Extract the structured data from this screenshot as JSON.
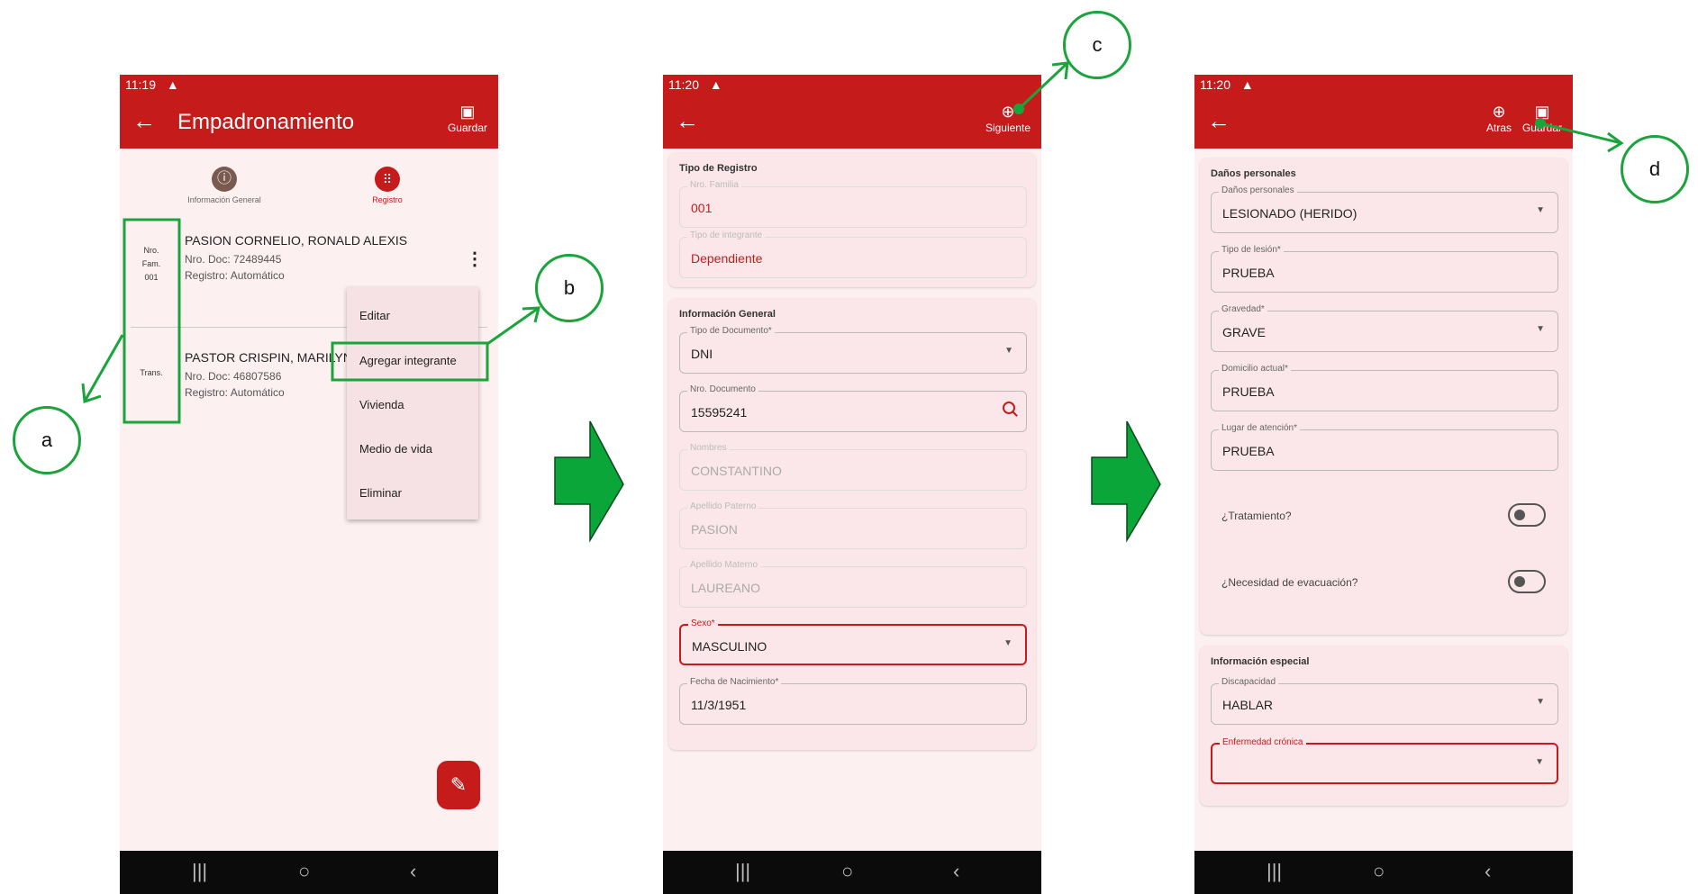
{
  "screen1": {
    "status": {
      "time": "11:19",
      "warn": "▲"
    },
    "appbar": {
      "title": "Empadronamiento",
      "save_label": "Guardar"
    },
    "tabs": [
      {
        "label": "Información General",
        "icon": "info-icon"
      },
      {
        "label": "Registro",
        "icon": "dialpad-icon"
      }
    ],
    "records": [
      {
        "badge": [
          "Nro.",
          "Fam.",
          "001"
        ],
        "name": "PASION CORNELIO, RONALD ALEXIS",
        "doc": "Nro. Doc: 72489445",
        "reg": "Registro: Automático"
      },
      {
        "badge": [
          "Trans."
        ],
        "name": "PASTOR CRISPIN, MARILYN",
        "doc": "Nro. Doc: 46807586",
        "reg": "Registro: Automático"
      }
    ],
    "menu": [
      "Editar",
      "Agregar integrante",
      "Vivienda",
      "Medio de vida",
      "Eliminar"
    ]
  },
  "screen2": {
    "status": {
      "time": "11:20",
      "warn": "▲"
    },
    "appbar": {
      "next_label": "Siguiente"
    },
    "section1": {
      "title": "Tipo de Registro",
      "fields": [
        {
          "label": "Nro. Familia",
          "value": "001"
        },
        {
          "label": "Tipo de integrante",
          "value": "Dependiente"
        }
      ]
    },
    "section2": {
      "title": "Información General",
      "fields": [
        {
          "label": "Tipo de Documento*",
          "value": "DNI"
        },
        {
          "label": "Nro. Documento",
          "value": "15595241"
        },
        {
          "label": "Nombres",
          "value": "CONSTANTINO"
        },
        {
          "label": "Apellido Paterno",
          "value": "PASION"
        },
        {
          "label": "Apellido Materno",
          "value": "LAUREANO"
        },
        {
          "label": "Sexo*",
          "value": "MASCULINO"
        },
        {
          "label": "Fecha de Nacimiento*",
          "value": "11/3/1951"
        }
      ]
    }
  },
  "screen3": {
    "status": {
      "time": "11:20",
      "warn": "▲"
    },
    "appbar": {
      "back_label": "Atras",
      "save_label": "Guardar"
    },
    "section1": {
      "title": "Daños personales",
      "fields": [
        {
          "label": "Daños personales",
          "value": "LESIONADO (HERIDO)"
        },
        {
          "label": "Tipo de lesión*",
          "value": "PRUEBA"
        },
        {
          "label": "Gravedad*",
          "value": "GRAVE"
        },
        {
          "label": "Domicilio actual*",
          "value": "PRUEBA"
        },
        {
          "label": "Lugar de atención*",
          "value": "PRUEBA"
        }
      ],
      "toggles": [
        "¿Tratamiento?",
        "¿Necesidad de evacuación?"
      ]
    },
    "section2": {
      "title": "Información especial",
      "fields": [
        {
          "label": "Discapacidad",
          "value": "HABLAR"
        },
        {
          "label": "Enfermedad crónica",
          "value": ""
        }
      ]
    }
  },
  "callouts": {
    "a": "a",
    "b": "b",
    "c": "c",
    "d": "d"
  },
  "nav": {
    "recents": "|||",
    "home": "○",
    "back": "‹"
  },
  "colors": {
    "brand_red": "#c51b1b",
    "callout_green": "#1ba33c",
    "arrow_green": "#0aa63a"
  }
}
